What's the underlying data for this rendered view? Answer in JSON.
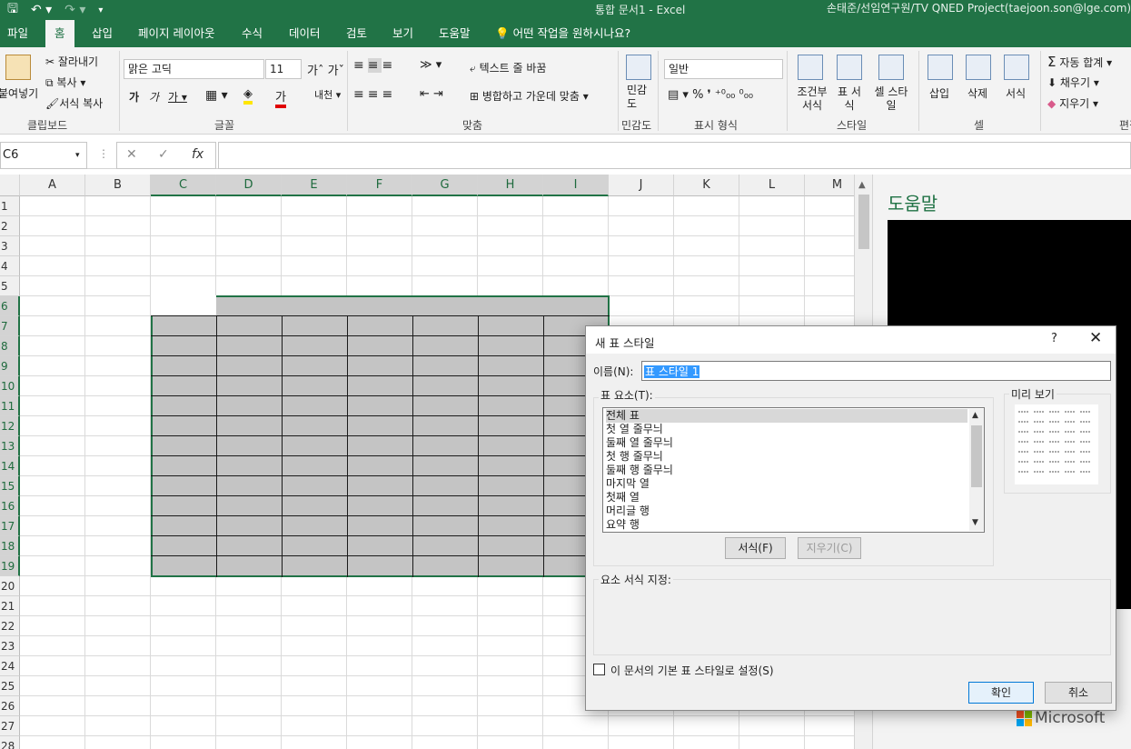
{
  "window": {
    "title": "통합 문서1 - Excel",
    "user": "손태준/선임연구원/TV QNED Project(taejoon.son@lge.com)"
  },
  "tabs": [
    "파일",
    "홈",
    "삽입",
    "페이지 레이아웃",
    "수식",
    "데이터",
    "검토",
    "보기",
    "도움말"
  ],
  "active_tab": "홈",
  "tell_me": "어떤 작업을 원하시나요?",
  "ribbon": {
    "clipboard": {
      "paste": "붙여넣기",
      "cut": "잘라내기",
      "copy": "복사",
      "format_painter": "서식 복사",
      "label": "클립보드"
    },
    "font": {
      "name": "맑은 고딕",
      "size": "11",
      "label": "글꼴"
    },
    "alignment": {
      "wrap": "텍스트 줄 바꿈",
      "merge": "병합하고 가운데 맞춤",
      "label": "맞춤"
    },
    "sensitivity": {
      "button": "민감도",
      "label": "민감도"
    },
    "number": {
      "format": "일반",
      "label": "표시 형식"
    },
    "styles": {
      "conditional": "조건부 서식",
      "table": "표 서식",
      "cell": "셀 스타일",
      "label": "스타일"
    },
    "cells": {
      "insert": "삽입",
      "delete": "삭제",
      "format": "서식",
      "label": "셀"
    },
    "editing": {
      "autosum": "자동 합계",
      "fill": "채우기",
      "clear": "지우기",
      "label": "편집"
    }
  },
  "formula_bar": {
    "name_box": "C6",
    "formula": ""
  },
  "columns": [
    "A",
    "B",
    "C",
    "D",
    "E",
    "F",
    "G",
    "H",
    "I",
    "J",
    "K",
    "L",
    "M"
  ],
  "selected_columns": [
    "C",
    "D",
    "E",
    "F",
    "G",
    "H",
    "I"
  ],
  "rows": [
    "1",
    "2",
    "3",
    "4",
    "5",
    "6",
    "7",
    "8",
    "9",
    "10",
    "11",
    "12",
    "13",
    "14",
    "15",
    "16",
    "17",
    "18",
    "19",
    "20",
    "21",
    "22",
    "23",
    "24",
    "25",
    "26",
    "27",
    "28"
  ],
  "selected_rows": [
    "6",
    "7",
    "8",
    "9",
    "10",
    "11",
    "12",
    "13",
    "14",
    "15",
    "16",
    "17",
    "18",
    "19"
  ],
  "help_pane": {
    "title": "도움말",
    "brand": "Microsoft"
  },
  "dialog": {
    "title": "새 표 스타일",
    "help": "?",
    "close": "✕",
    "name_label": "이름(N):",
    "name_value": "표 스타일 1",
    "elements_label": "표 요소(T):",
    "elements": [
      "전체 표",
      "첫 열 줄무늬",
      "둘째 열 줄무늬",
      "첫 행 줄무늬",
      "둘째 행 줄무늬",
      "마지막 열",
      "첫째 열",
      "머리글 행",
      "요약 행"
    ],
    "selected_element": "전체 표",
    "preview_label": "미리 보기",
    "format_button": "서식(F)",
    "clear_button": "지우기(C)",
    "element_format_label": "요소 서식 지정:",
    "default_checkbox_label": "이 문서의 기본 표 스타일로 설정(S)",
    "default_checked": false,
    "ok": "확인",
    "cancel": "취소"
  }
}
